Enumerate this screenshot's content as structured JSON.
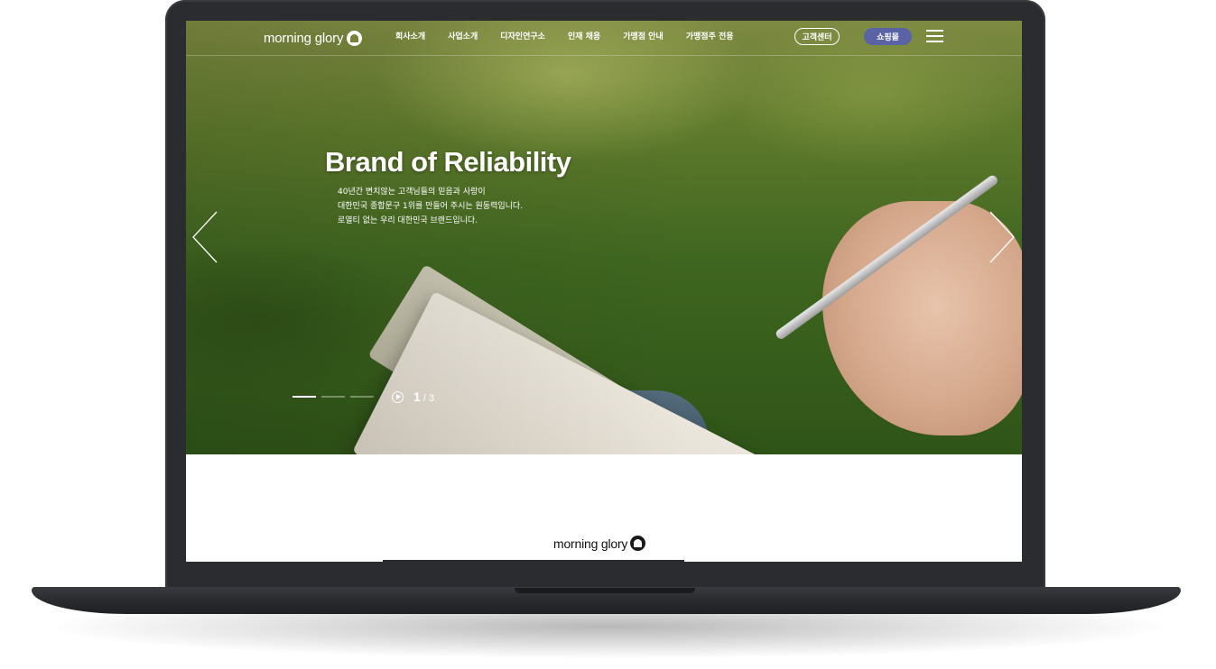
{
  "header": {
    "logo_text": "morning glory",
    "nav": [
      "회사소개",
      "사업소개",
      "디자인연구소",
      "인재 채용",
      "가맹점 안내",
      "가맹점주 전용"
    ],
    "customer_center_label": "고객센터",
    "shop_label": "쇼핑몰"
  },
  "hero": {
    "title": "Brand of Reliability",
    "lines": [
      "40년간 변치않는 고객님들의 믿음과 사랑이",
      "대한민국 종합문구 1위를 만들어 주시는 원동력입니다.",
      "로열티 없는 우리 대한민국 브랜드입니다."
    ],
    "current_slide": "1",
    "total_slides": " / 3",
    "active_slide_index": 1
  },
  "lower": {
    "logo_text": "morning glory"
  },
  "colors": {
    "shop_button": "#5a63a6",
    "laptop_frame": "#2b2c30"
  },
  "icons": [
    "logo-mark-icon",
    "menu-icon",
    "arrow-left-icon",
    "arrow-right-icon",
    "play-icon"
  ]
}
